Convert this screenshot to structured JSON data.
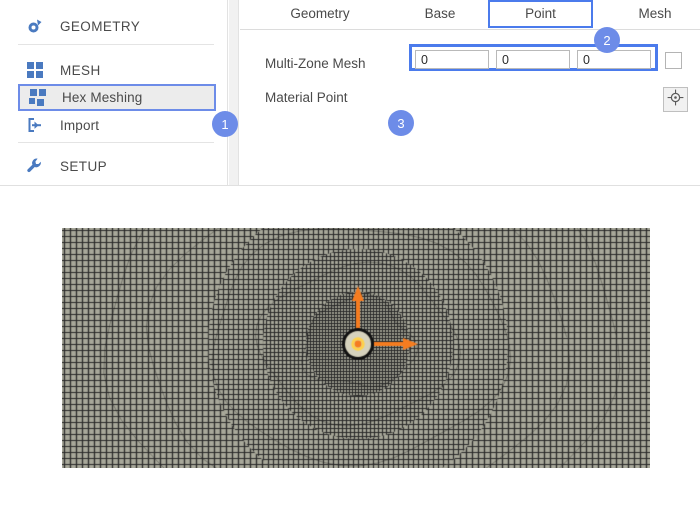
{
  "sidebar": {
    "items": [
      {
        "id": "geometry",
        "label": "GEOMETRY",
        "icon": "geometry-icon",
        "selected": false
      },
      {
        "id": "mesh",
        "label": "MESH",
        "icon": "grid-icon",
        "selected": false
      },
      {
        "id": "hex-meshing",
        "label": "Hex Meshing",
        "icon": "hex-mesh-icon",
        "selected": true
      },
      {
        "id": "import",
        "label": "Import",
        "icon": "import-arrow-icon",
        "selected": false
      },
      {
        "id": "setup",
        "label": "SETUP",
        "icon": "wrench-icon",
        "selected": false
      }
    ]
  },
  "properties": {
    "tabs": [
      {
        "id": "geometry",
        "label": "Geometry",
        "active": false
      },
      {
        "id": "base",
        "label": "Base",
        "active": false
      },
      {
        "id": "point",
        "label": "Point",
        "active": true
      },
      {
        "id": "mesh",
        "label": "Mesh",
        "active": false
      }
    ],
    "fields": {
      "multi_zone_mesh": {
        "label": "Multi-Zone Mesh",
        "checked": false
      },
      "material_point": {
        "label": "Material Point",
        "x": "0",
        "y": "0",
        "z": "0",
        "placeholder": "",
        "pick_button_icon": "crosshair-target-icon"
      }
    }
  },
  "callouts": [
    {
      "id": "callout-1",
      "number": "1"
    },
    {
      "id": "callout-2",
      "number": "2"
    },
    {
      "id": "callout-3",
      "number": "3"
    }
  ],
  "viewport": {
    "name": "hex-mesh-preview",
    "origin_marker": {
      "name": "material-point-origin-marker",
      "axis_arrows": [
        "up",
        "right"
      ]
    }
  },
  "colors": {
    "accent_blue": "#4b7bec",
    "callout_blue": "#6d8ce8",
    "icon_blue": "#4a7ac0",
    "selected_row_bg": "#ececec",
    "mesh_line": "#2a2a2a",
    "mesh_cell": "#a8a89a",
    "marker_orange": "#f57c20",
    "marker_yellow": "#ffd24a",
    "text": "#4a4a4a"
  }
}
